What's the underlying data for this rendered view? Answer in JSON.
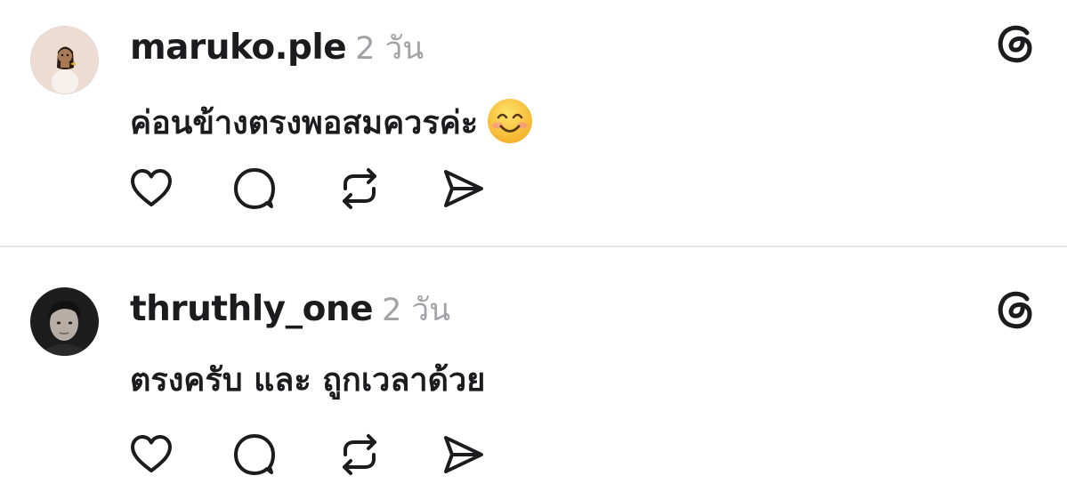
{
  "posts": [
    {
      "username": "maruko.ple",
      "time": "2 วัน",
      "text": "ค่อนข้างตรงพอสมควรค่ะ",
      "emoji": "smiling-face-emoji",
      "avatar": "cartoon-girl-avatar"
    },
    {
      "username": "thruthly_one",
      "time": "2 วัน",
      "text": "ตรงครับ และ ถูกเวลาด้วย",
      "avatar": "portrait-photo-avatar"
    }
  ],
  "icons": {
    "logo": "threads-logo-icon",
    "like": "heart-icon",
    "reply": "comment-bubble-icon",
    "repost": "repost-icon",
    "share": "send-icon"
  },
  "colors": {
    "text": "#1c1c1e",
    "timestamp": "#a2a2a6",
    "divider": "#e6e6e8"
  }
}
